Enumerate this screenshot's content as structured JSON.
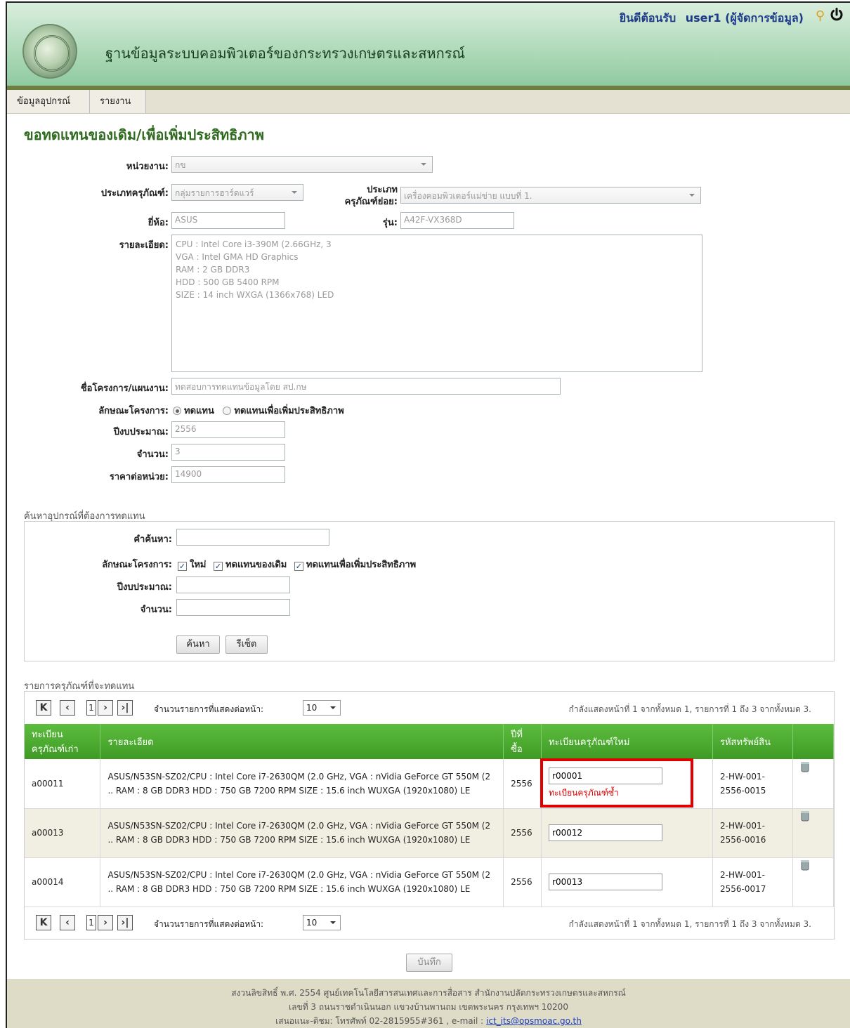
{
  "header": {
    "title": "ฐานข้อมูลระบบคอมพิวเตอร์ของกระทรวงเกษตรและสหกรณ์",
    "welcome": "ยินดีต้อนรับ",
    "user": "user1 (ผู้จัดการข้อมูล)"
  },
  "menu": {
    "devices": "ข้อมูลอุปกรณ์",
    "reports": "รายงาน"
  },
  "page_title": "ขอทดแทนของเดิม/เพื่อเพิ่มประสิทธิภาพ",
  "form": {
    "agency_label": "หน่วยงาน:",
    "agency_value": "กข",
    "type_label": "ประเภทครุภัณฑ์:",
    "type_value": "กลุ่มรายการฮาร์ดแวร์",
    "subtype_label_1": "ประเภท",
    "subtype_label_2": "ครุภัณฑ์ย่อย:",
    "subtype_value": "เครื่องคอมพิวเตอร์แม่ข่าย แบบที่ 1.",
    "brand_label": "ยี่ห้อ:",
    "brand_value": "ASUS",
    "model_label": "รุ่น:",
    "model_value": "A42F-VX368D",
    "detail_label": "รายละเอียด:",
    "detail_lines": [
      "CPU : Intel Core i3-390M (2.66GHz, 3",
      "VGA : Intel GMA HD Graphics",
      "RAM : 2 GB DDR3",
      "HDD : 500 GB 5400 RPM",
      "SIZE : 14 inch WXGA (1366x768) LED"
    ],
    "project_label": "ชื่อโครงการ/แผนงาน:",
    "project_value": "ทดสอบการทดแทนข้อมูลโดย สป.กษ",
    "nature_label": "ลักษณะโครงการ:",
    "nature_opt1": "ทดแทน",
    "nature_opt2": "ทดแทนเพื่อเพิ่มประสิทธิภาพ",
    "budget_label": "ปีงบประมาณ:",
    "budget_value": "2556",
    "qty_label": "จำนวน:",
    "qty_value": "3",
    "price_label": "ราคาต่อหน่วย:",
    "price_value": "14900"
  },
  "search": {
    "caption": "ค้นหาอุปกรณ์ที่ต้องการทดแทน",
    "keyword_label": "คำค้นหา:",
    "nature_label": "ลักษณะโครงการ:",
    "chk_new": "ใหม่",
    "chk_replace": "ทดแทนของเดิม",
    "chk_improve": "ทดแทนเพื่อเพิ่มประสิทธิภาพ",
    "budget_label": "ปีงบประมาณ:",
    "qty_label": "จำนวน:",
    "search_button": "ค้นหา",
    "reset_button": "รีเซ็ต"
  },
  "results": {
    "caption": "รายการครุภัณฑ์ที่จะทดแทน",
    "page": "1",
    "per_page_label": "จำนวนรายการที่แสดงต่อหน้า:",
    "per_page": "10",
    "status": "กำลังแสดงหน้าที่ 1 จากทั้งหมด 1, รายการที่ 1 ถึง 3 จากทั้งหมด 3.",
    "columns": [
      "ทะเบียนครุภัณฑ์เก่า",
      "รายละเอียด",
      "ปีที่ซื้อ",
      "ทะเบียนครุภัณฑ์ใหม่",
      "รหัสทรัพย์สิน"
    ],
    "rows": [
      {
        "old_reg": "a00011",
        "detail": "ASUS/N53SN-SZ02/CPU : Intel Core i7-2630QM (2.0 GHz, VGA : nVidia GeForce GT 550M (2 .. RAM : 8 GB DDR3 HDD : 750 GB 7200 RPM SIZE : 15.6 inch WUXGA (1920x1080) LE",
        "year": "2556",
        "new_reg": "r00001",
        "error": "ทะเบียนครุภัณฑ์ซ้ำ",
        "asset": "2-HW-001-2556-0015"
      },
      {
        "old_reg": "a00013",
        "detail": "ASUS/N53SN-SZ02/CPU : Intel Core i7-2630QM (2.0 GHz, VGA : nVidia GeForce GT 550M (2 .. RAM : 8 GB DDR3 HDD : 750 GB 7200 RPM SIZE : 15.6 inch WUXGA (1920x1080) LE",
        "year": "2556",
        "new_reg": "r00012",
        "error": "",
        "asset": "2-HW-001-2556-0016"
      },
      {
        "old_reg": "a00014",
        "detail": "ASUS/N53SN-SZ02/CPU : Intel Core i7-2630QM (2.0 GHz, VGA : nVidia GeForce GT 550M (2 .. RAM : 8 GB DDR3 HDD : 750 GB 7200 RPM SIZE : 15.6 inch WUXGA (1920x1080) LE",
        "year": "2556",
        "new_reg": "r00013",
        "error": "",
        "asset": "2-HW-001-2556-0017"
      }
    ]
  },
  "save_button": "บันทึก",
  "footer": {
    "line1": "สงวนลิขสิทธิ์ พ.ศ. 2554 ศูนย์เทคโนโลยีสารสนเทศและการสื่อสาร สำนักงานปลัดกระทรวงเกษตรและสหกรณ์",
    "line2": "เลขที่ 3 ถนนราชดำเนินนอก แขวงบ้านพานถม เขตพระนคร กรุงเทพฯ 10200",
    "line3": "เสนอแนะ-ติชม: โทรศัพท์ 02-2815955#361 , e-mail :",
    "email": "ict_its@opsmoac.go.th"
  },
  "colors": {
    "header_green": "#8fcaa0",
    "grid_header": "#4aa82f",
    "title_green": "#2f6b1f",
    "error_red": "#dd0000"
  }
}
